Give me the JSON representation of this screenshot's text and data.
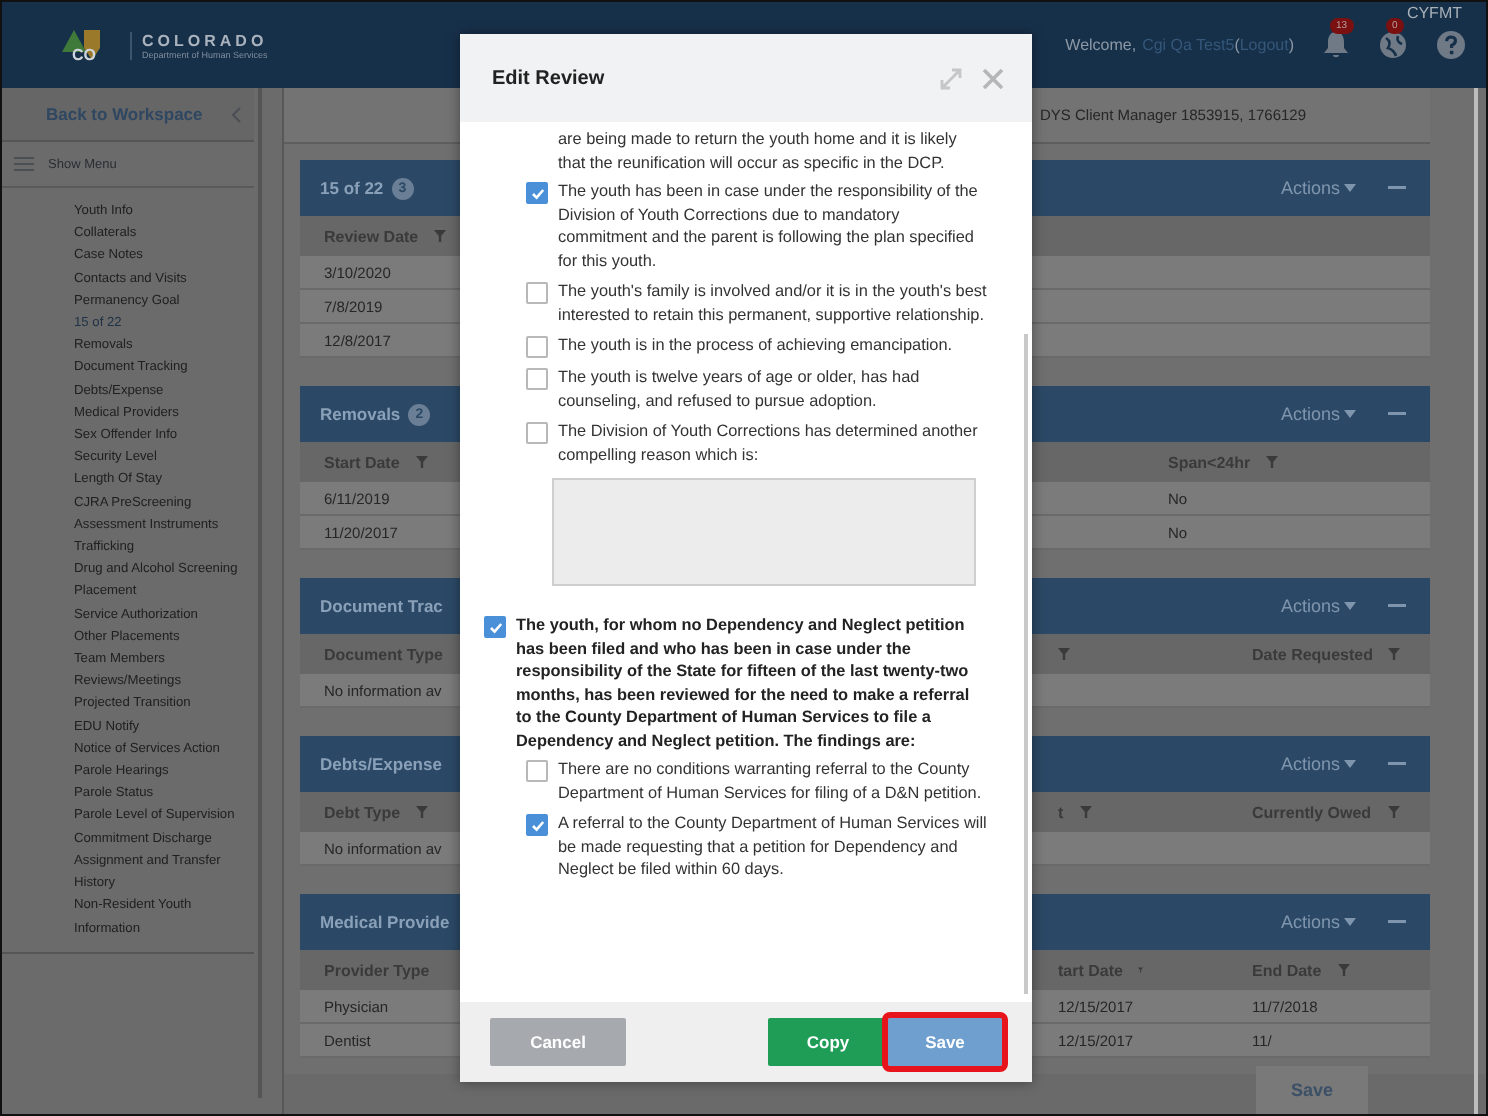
{
  "header": {
    "logo_mark": "CO",
    "logo_title": "COLORADO",
    "logo_subtitle": "Department of Human Services",
    "welcome": "Welcome,",
    "user": "Cgi Qa Test5",
    "logout": {
      "open": "(",
      "label": "Logout",
      "close": ")"
    },
    "notifications": [
      {
        "kind": "bell",
        "count": "13"
      },
      {
        "kind": "globe",
        "count": "0"
      }
    ],
    "app_label": "CYFMT"
  },
  "sidebar": {
    "back": "Back to Workspace",
    "show_menu": "Show Menu",
    "items": [
      {
        "label": "Youth Info",
        "kind": "link"
      },
      {
        "label": "Collaterals",
        "kind": "link"
      },
      {
        "label": "Case Notes",
        "kind": "link"
      },
      {
        "label": "Contacts and Visits",
        "kind": "link"
      },
      {
        "label": "Permanency Goal",
        "kind": "link"
      },
      {
        "label": "15 of 22",
        "kind": "count"
      },
      {
        "label": "Removals",
        "kind": "link"
      },
      {
        "label": "Document Tracking",
        "kind": "link"
      },
      {
        "label": "Debts/Expense",
        "kind": "link"
      },
      {
        "label": "Medical Providers",
        "kind": "link"
      },
      {
        "label": "Sex Offender Info",
        "kind": "link"
      },
      {
        "label": "Security Level",
        "kind": "link"
      },
      {
        "label": "Length Of Stay",
        "kind": "link"
      },
      {
        "label": "CJRA PreScreening",
        "kind": "link"
      },
      {
        "label": "Assessment Instruments",
        "kind": "link"
      },
      {
        "label": "Trafficking",
        "kind": "link"
      },
      {
        "label": "Drug and Alcohol Screening",
        "kind": "link"
      },
      {
        "label": "Placement",
        "kind": "link"
      },
      {
        "label": "Service Authorization",
        "kind": "link"
      },
      {
        "label": "Other Placements",
        "kind": "link"
      },
      {
        "label": "Team Members",
        "kind": "link"
      },
      {
        "label": "Reviews/Meetings",
        "kind": "link"
      },
      {
        "label": "Projected Transition",
        "kind": "link"
      },
      {
        "label": "EDU Notify",
        "kind": "link"
      },
      {
        "label": "Notice of Services Action",
        "kind": "link"
      },
      {
        "label": "Parole Hearings",
        "kind": "link"
      },
      {
        "label": "Parole Status",
        "kind": "link"
      },
      {
        "label": "Parole Level of Supervision",
        "kind": "link"
      },
      {
        "label": "Commitment Discharge",
        "kind": "link"
      },
      {
        "label": "Assignment and Transfer History",
        "kind": "link"
      },
      {
        "label": "Non-Resident Youth Information",
        "kind": "link"
      }
    ]
  },
  "client_line": "DYS Client Manager 1853915, 1766129",
  "panels": [
    {
      "title": "15 of 22",
      "badge": "3",
      "actions": "Actions",
      "left_columns": [
        {
          "label": "Review Date",
          "filter": true
        }
      ],
      "rows": [
        {
          "left": [
            "3/10/2020"
          ]
        },
        {
          "left": [
            "7/8/2019"
          ]
        },
        {
          "left": [
            "12/8/2017"
          ]
        }
      ]
    },
    {
      "title": "Removals",
      "badge": "2",
      "actions": "Actions",
      "left_columns": [
        {
          "label": "Start Date",
          "filter": true
        }
      ],
      "right_columns": [
        {
          "label": "Span<24hr",
          "filter": true
        }
      ],
      "rows": [
        {
          "left": [
            "6/11/2019"
          ],
          "right": [
            "No"
          ]
        },
        {
          "left": [
            "11/20/2017"
          ],
          "right": [
            "No"
          ]
        }
      ]
    },
    {
      "title": "Document Trac",
      "actions": "Actions",
      "left_columns": [
        {
          "label": "Document Type",
          "filter": false
        }
      ],
      "right_columns": [
        {
          "filter": true
        },
        {
          "label": "Date Requested",
          "filter": true
        }
      ],
      "rows": [
        {
          "left": [
            "No information av"
          ]
        }
      ]
    },
    {
      "title": "Debts/Expense",
      "actions": "Actions",
      "left_columns": [
        {
          "label": "Debt Type",
          "filter": true
        }
      ],
      "right_columns": [
        {
          "label": "t",
          "filter": true
        },
        {
          "label": "Currently Owed",
          "filter": true
        }
      ],
      "rows": [
        {
          "left": [
            "No information av"
          ]
        }
      ]
    },
    {
      "title": "Medical Provide",
      "actions": "Actions",
      "left_columns": [
        {
          "label": "Provider Type",
          "filter": false
        }
      ],
      "right_columns": [
        {
          "label": "tart Date",
          "filter": true
        },
        {
          "label": "End Date",
          "filter": true
        }
      ],
      "rows": [
        {
          "left": [
            "Physician"
          ],
          "right": [
            "12/15/2017",
            "11/7/2018"
          ]
        },
        {
          "left": [
            "Dentist"
          ],
          "right": [
            "12/15/2017",
            "11/"
          ]
        }
      ]
    }
  ],
  "page_save": "Save",
  "modal": {
    "title": "Edit Review",
    "intro": "are being made to return the youth home and it is likely that the reunification will occur as specific in the DCP.",
    "options": [
      {
        "label": "The youth has been in case under the responsibility of the Division of Youth Corrections due to mandatory commitment and the parent is following the plan specified for this youth.",
        "checked": true
      },
      {
        "label": "The youth's family is involved and/or it is in the youth's best interested to retain this permanent, supportive relationship.",
        "checked": false
      },
      {
        "label": "The youth is in the process of achieving emancipation.",
        "checked": false
      },
      {
        "label": "The youth is twelve years of age or older, has had counseling, and refused to pursue adoption.",
        "checked": false
      },
      {
        "label": "The Division of Youth Corrections has determined another compelling reason which is:",
        "checked": false
      }
    ],
    "finding": {
      "label": "The youth, for whom no Dependency and Neglect petition has been filed and who has been in case under the responsibility of the State for fifteen of the last twenty-two months, has been reviewed for the need to make a referral to the County Department of Human Services to file a Dependency and Neglect petition. The findings are:",
      "checked": true,
      "children": [
        {
          "label": "There are no conditions warranting referral to the County Department of Human Services for filing of a D&N petition.",
          "checked": false
        },
        {
          "label": "A referral to the County Department of Human Services will be made requesting that a petition for Dependency and Neglect be filed within 60 days.",
          "checked": true
        }
      ]
    },
    "buttons": [
      {
        "label": "Cancel",
        "kind": "cancel",
        "highlighted": false
      },
      {
        "label": "Copy",
        "kind": "copy",
        "highlighted": false
      },
      {
        "label": "Save",
        "kind": "save",
        "highlighted": true
      }
    ]
  }
}
